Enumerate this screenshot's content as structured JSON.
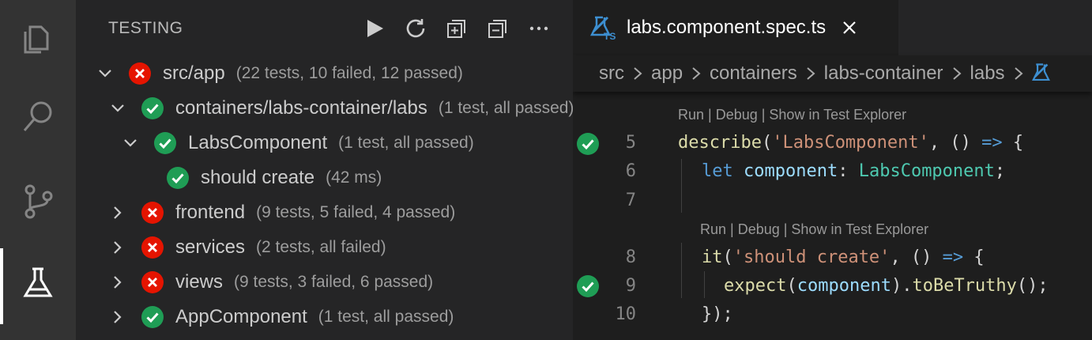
{
  "activity_bar": {
    "icons": [
      "explorer-icon",
      "search-icon",
      "source-control-icon",
      "testing-icon"
    ],
    "active": "testing-icon"
  },
  "sidebar": {
    "title": "TESTING",
    "actions": [
      "run-all-icon",
      "refresh-icon",
      "expand-icon",
      "collapse-icon",
      "more-icon"
    ],
    "tree": [
      {
        "label": "src/app",
        "desc": "(22 tests, 10 failed, 12 passed)",
        "status": "failed",
        "expanded": true
      },
      {
        "label": "containers/labs-container/labs",
        "desc": "(1 test, all passed)",
        "status": "passed",
        "expanded": true
      },
      {
        "label": "LabsComponent",
        "desc": "(1 test, all passed)",
        "status": "passed",
        "expanded": true
      },
      {
        "label": "should create",
        "desc": "(42 ms)",
        "status": "passed",
        "expanded": null
      },
      {
        "label": "frontend",
        "desc": "(9 tests, 5 failed, 4 passed)",
        "status": "failed",
        "expanded": false
      },
      {
        "label": "services",
        "desc": "(2 tests, all failed)",
        "status": "failed",
        "expanded": false
      },
      {
        "label": "views",
        "desc": "(9 tests, 3 failed, 6 passed)",
        "status": "failed",
        "expanded": false
      },
      {
        "label": "AppComponent",
        "desc": "(1 test, all passed)",
        "status": "passed",
        "expanded": false
      }
    ]
  },
  "editor": {
    "tab": {
      "filename": "labs.component.spec.ts",
      "badge": "TS"
    },
    "breadcrumbs": [
      "src",
      "app",
      "containers",
      "labs-container",
      "labs"
    ],
    "codelens": "Run | Debug | Show in Test Explorer",
    "lines": {
      "l5": {
        "num": "5",
        "describe": "describe",
        "str": "'LabsComponent'",
        "rest": ", () ",
        "arrow": "=>",
        "brace": " {"
      },
      "l6": {
        "num": "6",
        "kw": "let",
        "var": "component",
        "colon": ": ",
        "type": "LabsComponent",
        "semi": ";"
      },
      "l7": {
        "num": "7"
      },
      "l8": {
        "num": "8",
        "fn": "it",
        "open": "(",
        "str": "'should create'",
        "rest": ", () ",
        "arrow": "=>",
        "brace": " {"
      },
      "l9": {
        "num": "9",
        "fn": "expect",
        "open": "(",
        "var": "component",
        "close": ").",
        "fn2": "toBeTruthy",
        "end": "();"
      },
      "l10": {
        "num": "10",
        "text": "});"
      }
    }
  },
  "colors": {
    "passed": "#1f9d55",
    "failed": "#e51400",
    "accent": "#007acc"
  }
}
